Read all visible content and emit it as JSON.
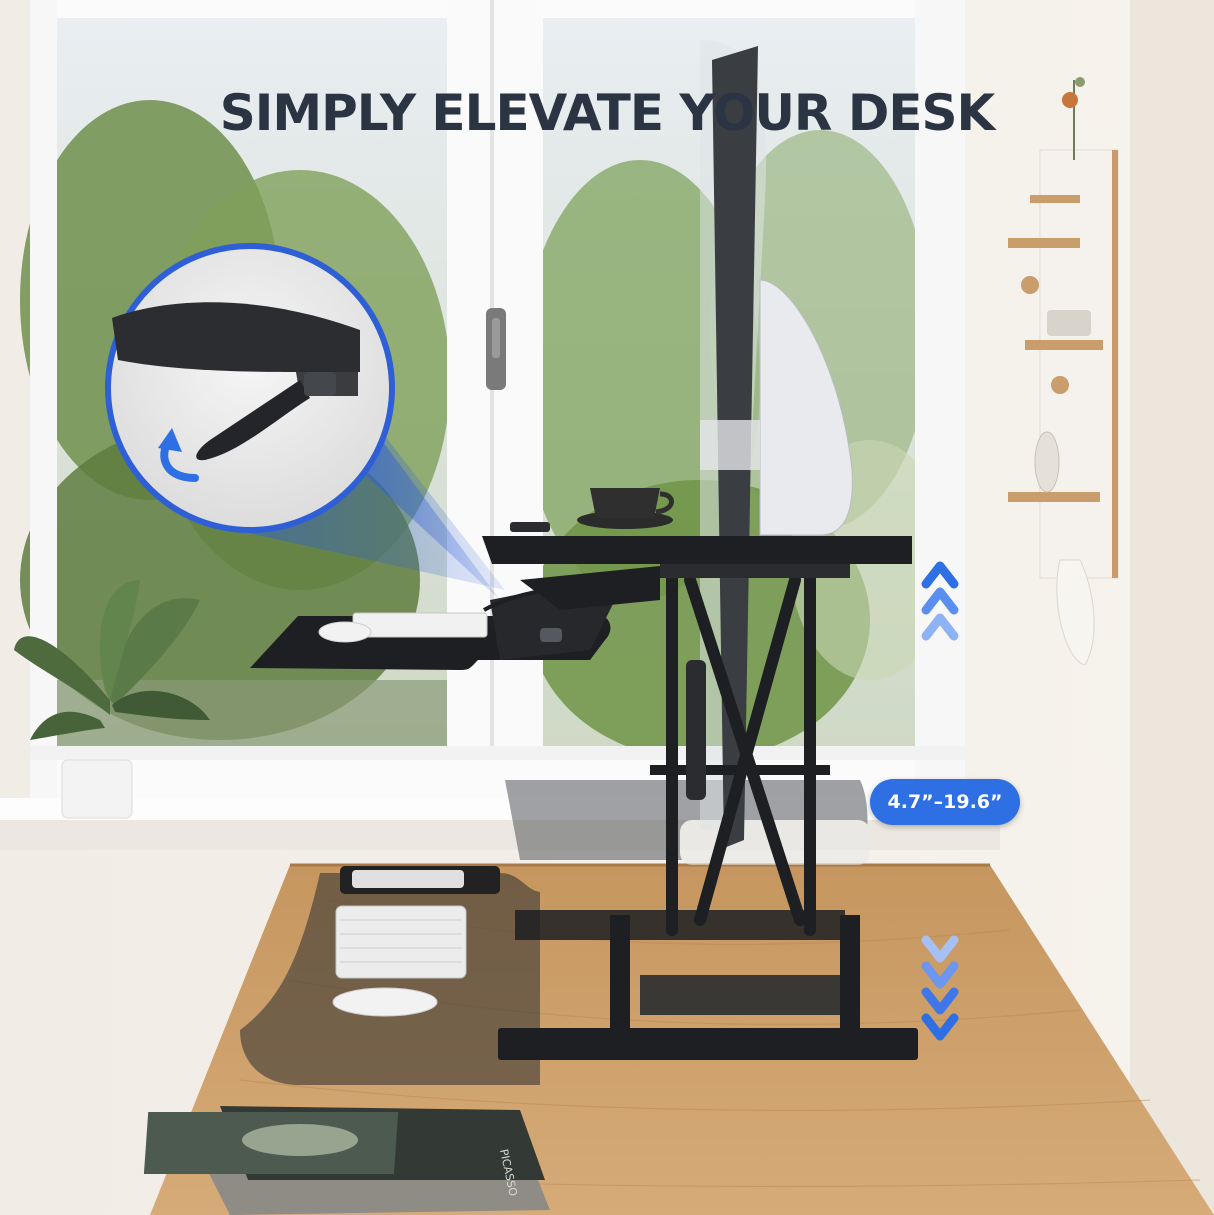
{
  "headline": "SIMPLY ELEVATE YOUR DESK",
  "height_range": "4.7”–19.6”",
  "book_title": "PICASSO",
  "colors": {
    "headline": "#2a3442",
    "accent_blue": "#2f6fe4",
    "desk_wood": "#c89a66",
    "converter_black": "#1d1f22"
  },
  "icons": [
    "lever-rotate-arrow-icon",
    "raise-chevrons-icon",
    "lower-chevrons-icon"
  ]
}
